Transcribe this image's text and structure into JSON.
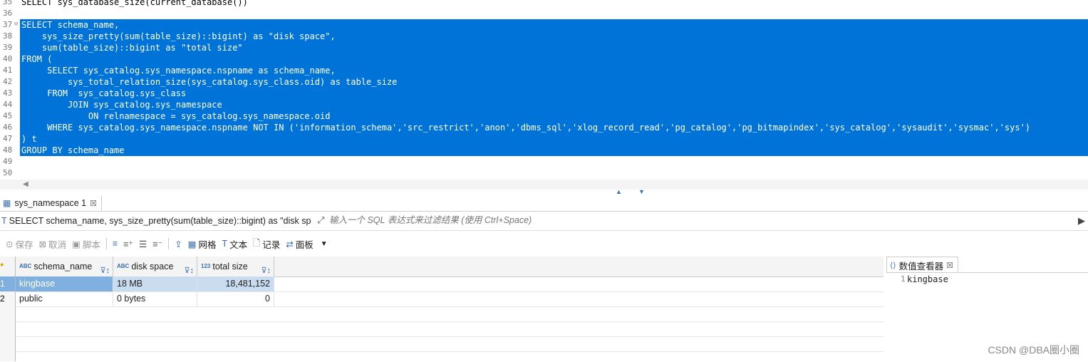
{
  "editor": {
    "lines": [
      {
        "num": "35",
        "text": "SELECT sys_database_size(current_database())",
        "selected": false
      },
      {
        "num": "36",
        "text": "",
        "selected": false
      },
      {
        "num": "37",
        "text": "SELECT schema_name,",
        "selected": true
      },
      {
        "num": "38",
        "text": "    sys_size_pretty(sum(table_size)::bigint) as \"disk space\",",
        "selected": true
      },
      {
        "num": "39",
        "text": "    sum(table_size)::bigint as \"total size\"",
        "selected": true
      },
      {
        "num": "40",
        "text": "FROM (",
        "selected": true
      },
      {
        "num": "41",
        "text": "     SELECT sys_catalog.sys_namespace.nspname as schema_name,",
        "selected": true
      },
      {
        "num": "42",
        "text": "         sys_total_relation_size(sys_catalog.sys_class.oid) as table_size",
        "selected": true
      },
      {
        "num": "43",
        "text": "     FROM  sys_catalog.sys_class",
        "selected": true
      },
      {
        "num": "44",
        "text": "         JOIN sys_catalog.sys_namespace",
        "selected": true
      },
      {
        "num": "45",
        "text": "             ON relnamespace = sys_catalog.sys_namespace.oid",
        "selected": true
      },
      {
        "num": "46",
        "text": "     WHERE sys_catalog.sys_namespace.nspname NOT IN ('information_schema','src_restrict','anon','dbms_sql','xlog_record_read','pg_catalog','pg_bitmapindex','sys_catalog','sysaudit','sysmac','sys')",
        "selected": true
      },
      {
        "num": "47",
        "text": ") t",
        "selected": true
      },
      {
        "num": "48",
        "text": "GROUP BY schema_name",
        "selected": true
      },
      {
        "num": "49",
        "text": "",
        "selected": false
      },
      {
        "num": "50",
        "text": "",
        "selected": false
      }
    ]
  },
  "result_tab": {
    "label": "sys_namespace 1",
    "close": "☒"
  },
  "filter": {
    "query_text": "SELECT schema_name, sys_size_pretty(sum(table_size)::bigint) as \"disk sp",
    "placeholder": "输入一个 SQL 表达式来过滤结果 (使用 Ctrl+Space)"
  },
  "toolbar": {
    "save": "保存",
    "cancel": "取消",
    "script": "脚本",
    "grid": "网格",
    "text": "文本",
    "record": "记录",
    "panel": "面板"
  },
  "table": {
    "columns": [
      {
        "type": "ABC",
        "name": "schema_name"
      },
      {
        "type": "ABC",
        "name": "disk space"
      },
      {
        "type": "123",
        "name": "total size"
      }
    ],
    "rows": [
      {
        "num": "1",
        "schema_name": "kingbase",
        "disk_space": "18 MB",
        "total_size": "18,481,152"
      },
      {
        "num": "2",
        "schema_name": "public",
        "disk_space": "0 bytes",
        "total_size": "0"
      }
    ]
  },
  "viewer": {
    "title": "数值查看器",
    "line_num": "1",
    "value": "kingbase"
  },
  "watermark": "CSDN @DBA圈小圈",
  "colors": {
    "selection": "#0073d9",
    "accent": "#3a6fb0"
  }
}
